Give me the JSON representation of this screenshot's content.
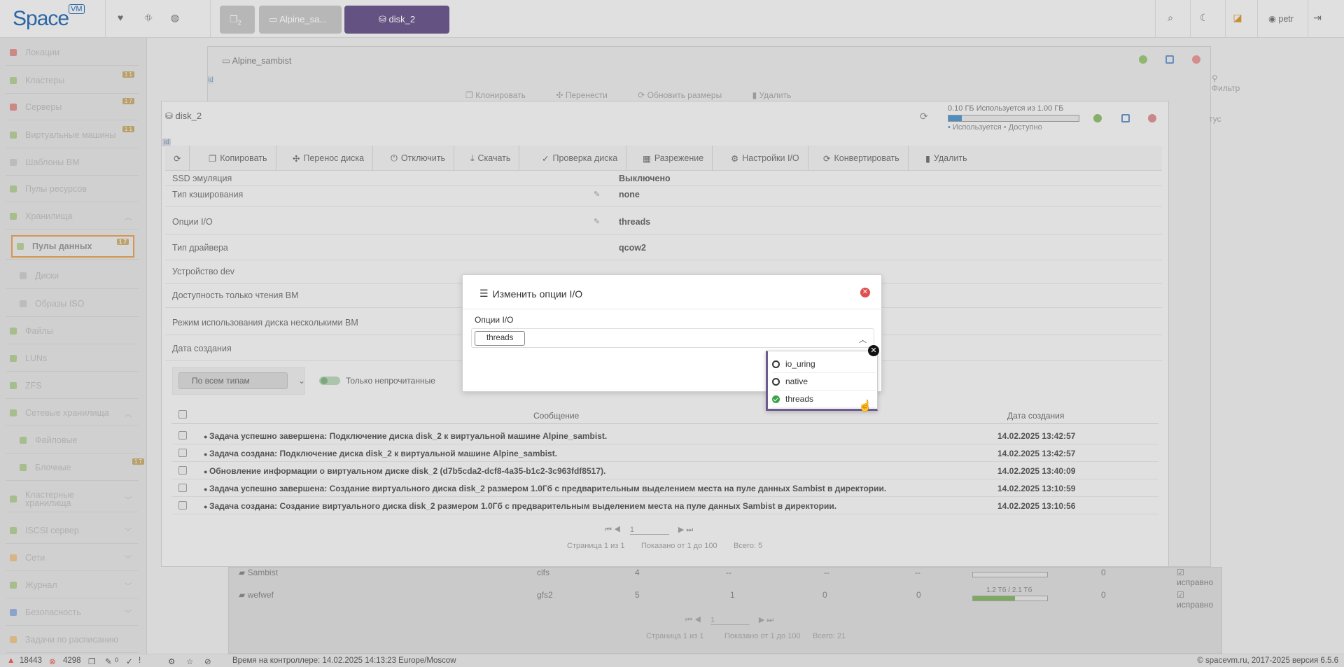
{
  "app": {
    "logo_text": "Space",
    "logo_badge": "VM",
    "user": "petr"
  },
  "top_tabs": [
    {
      "label": "",
      "badge": "2"
    },
    {
      "label": "Alpine_sa..."
    },
    {
      "label": "disk_2"
    }
  ],
  "sidebar": {
    "items": [
      {
        "label": "Локации",
        "color": "#d9534f"
      },
      {
        "label": "Кластеры",
        "badge": "1 1",
        "color": "#8fbf5f"
      },
      {
        "label": "Серверы",
        "badge": "1 7",
        "color": "#d9534f"
      },
      {
        "label": "Виртуальные машины",
        "badge": "1 1",
        "color": "#8fbf5f"
      },
      {
        "label": "Шаблоны ВМ",
        "color": "#bbb"
      },
      {
        "label": "Пулы ресурсов",
        "color": "#8fbf5f"
      },
      {
        "label": "Хранилища",
        "color": "#8fbf5f",
        "chevron": "up"
      },
      {
        "label": "Пулы данных",
        "badge": "1 7",
        "color": "#8fbf5f",
        "active": true
      },
      {
        "label": "Диски",
        "color": "#bbb"
      },
      {
        "label": "Образы ISO",
        "color": "#bbb"
      },
      {
        "label": "Файлы",
        "color": "#8fbf5f"
      },
      {
        "label": "LUNs",
        "color": "#8fbf5f"
      },
      {
        "label": "ZFS",
        "color": "#8fbf5f"
      },
      {
        "label": "Сетевые хранилища",
        "color": "#8fbf5f",
        "chevron": "up"
      },
      {
        "label": "Файловые",
        "color": "#8fbf5f"
      },
      {
        "label": "Блочные",
        "badge": "1 7",
        "color": "#8fbf5f"
      },
      {
        "label": "Кластерные хранилища",
        "color": "#8fbf5f",
        "chevron": "down"
      },
      {
        "label": "ISCSI сервер",
        "color": "#8fbf5f",
        "chevron": "down"
      },
      {
        "label": "Сети",
        "color": "#f0ad4e",
        "chevron": "down"
      },
      {
        "label": "Журнал",
        "color": "#8fbf5f",
        "chevron": "down"
      },
      {
        "label": "Безопасность",
        "color": "#5b8bd9",
        "chevron": "down"
      },
      {
        "label": "Задачи по расписанию",
        "color": "#f0ad4e"
      }
    ]
  },
  "vm_window": {
    "title": "Alpine_sambist",
    "id_tag": "id",
    "toolbar": [
      "Клонировать",
      "Перенести",
      "Обновить размеры",
      "Удалить"
    ],
    "filter_label": "Фильтр",
    "status_col": "тус",
    "rows": [
      {
        "name": "Sambist",
        "type": "cifs",
        "n": "4",
        "a": "--",
        "b": "--",
        "c": "--",
        "d": "0",
        "status": "исправно"
      },
      {
        "name": "wefwef",
        "type": "gfs2",
        "n": "5",
        "a": "1",
        "b": "0",
        "c": "0",
        "usage": "1.2 Тб / 2.1 Тб",
        "d": "0",
        "status": "исправно"
      }
    ],
    "pager": {
      "page": "1",
      "text_pages": "Страница 1 из 1",
      "text_shown": "Показано от 1 до 100",
      "text_total": "Всего: 21"
    }
  },
  "disk_window": {
    "title": "disk_2",
    "id_tag": "id",
    "usage": {
      "text": "0.10 ГБ  Используется из  1.00 ГБ",
      "used_fraction": 0.1,
      "legend_used": "Используется",
      "legend_free": "Доступно"
    },
    "toolbar": {
      "copy": "Копировать",
      "move": "Перенос диска",
      "detach": "Отключить",
      "download": "Скачать",
      "check": "Проверка диска",
      "resize": "Разрежение",
      "io": "Настройки I/O",
      "convert": "Конвертировать",
      "delete": "Удалить"
    },
    "props": [
      {
        "label": "SSD эмуляция",
        "value": "Выключено"
      },
      {
        "label": "Тип кэширования",
        "value": "none",
        "editable": true
      },
      {
        "label": "Опции I/O",
        "value": "threads",
        "editable": true
      },
      {
        "label": "Тип драйвера",
        "value": "qcow2"
      },
      {
        "label": "Устройство dev",
        "value": ""
      },
      {
        "label": "Доступность только чтения ВМ",
        "value": ""
      },
      {
        "label": "Режим использования диска несколькими ВМ",
        "value": ""
      },
      {
        "label": "Дата создания",
        "value": ""
      }
    ],
    "filters": {
      "type_select": "По всем типам",
      "unread_label": "Только непрочитанные"
    },
    "events_table": {
      "headers": {
        "message": "Сообщение",
        "date": "Дата создания"
      },
      "rows": [
        {
          "message": "Задача успешно завершена: Подключение диска disk_2 к виртуальной машине Alpine_sambist.",
          "date": "14.02.2025 13:42:57"
        },
        {
          "message": "Задача создана: Подключение диска disk_2 к виртуальной машине Alpine_sambist.",
          "date": "14.02.2025 13:42:57"
        },
        {
          "message": "Обновление информации о виртуальном диске disk_2 (d7b5cda2-dcf8-4a35-b1c2-3c963fdf8517).",
          "date": "14.02.2025 13:40:09"
        },
        {
          "message": "Задача успешно завершена: Создание виртуального диска disk_2 размером 1.0Гб с предварительным выделением места на пуле данных Sambist в директории.",
          "date": "14.02.2025 13:10:59"
        },
        {
          "message": "Задача создана: Создание виртуального диска disk_2 размером 1.0Гб с предварительным выделением места на пуле данных Sambist в директории.",
          "date": "14.02.2025 13:10:56"
        }
      ]
    },
    "pager": {
      "page": "1",
      "text_pages": "Страница 1 из 1",
      "text_shown": "Показано от 1 до 100",
      "text_total": "Всего: 5"
    }
  },
  "modal": {
    "title": "Изменить опции I/O",
    "field_label": "Опции I/O",
    "selected_value": "threads"
  },
  "dropdown": {
    "options": [
      {
        "label": "io_uring",
        "selected": false
      },
      {
        "label": "native",
        "selected": false
      },
      {
        "label": "threads",
        "selected": true
      }
    ]
  },
  "status_bar": {
    "warnings": "18443",
    "errors": "4298",
    "tools_count": "0",
    "controller_time": "Время на контроллере: 14.02.2025 14:13:23 Europe/Moscow",
    "copyright": "© spacevm.ru, 2017-2025 версия 6.5.6"
  }
}
